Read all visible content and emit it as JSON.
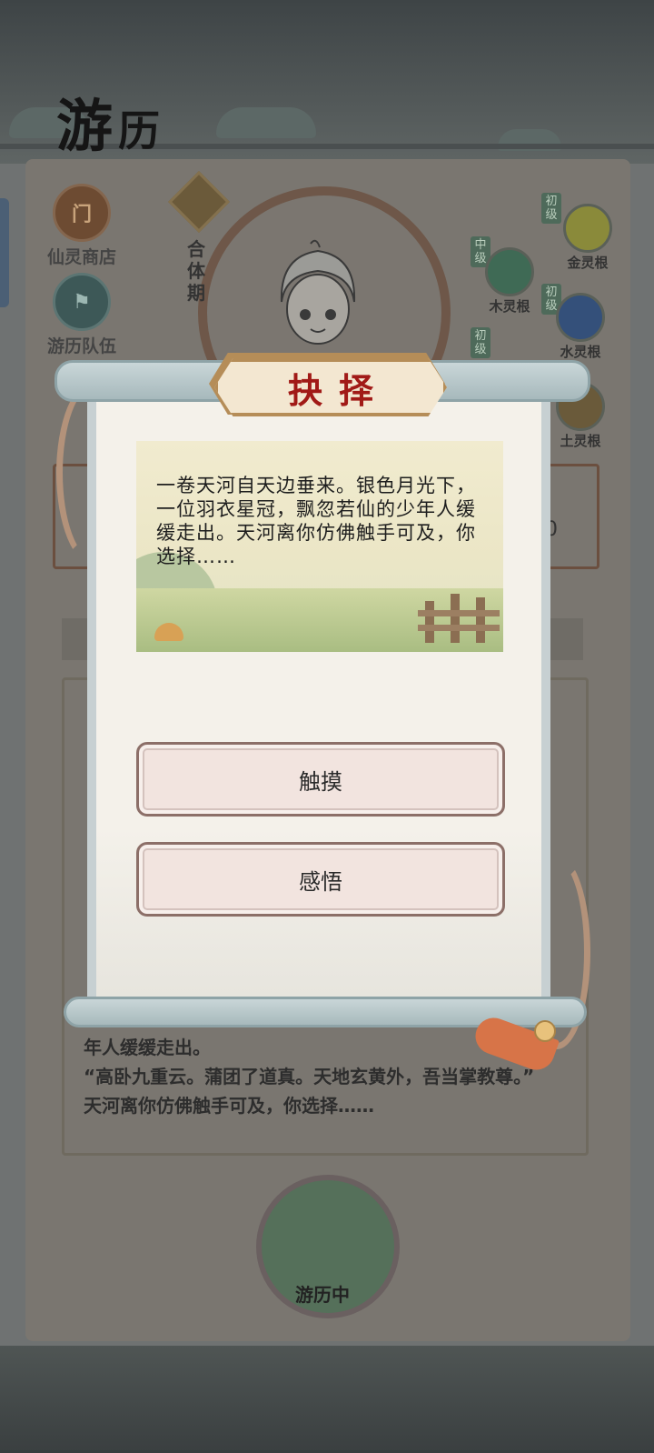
{
  "page": {
    "title_first": "游",
    "title_second": "历"
  },
  "side_buttons": {
    "shop_label": "仙灵商店",
    "team_label": "游历队伍"
  },
  "character": {
    "realm": "合体期"
  },
  "spirit_roots": [
    {
      "grade": "初级",
      "label": "金灵根",
      "color": "#8a8a3a"
    },
    {
      "grade": "中级",
      "label": "木灵根",
      "color": "#3f6a55"
    },
    {
      "grade": "初级",
      "label": "水灵根",
      "color": "#34507a"
    },
    {
      "grade": "初级",
      "label": "",
      "color": "#6a3e30"
    },
    {
      "grade": "",
      "label": "土灵根",
      "color": "#6a5a3a"
    }
  ],
  "background": {
    "row_value": "0",
    "log_lines": [
      "年人缓缓走出。",
      "“高卧九重云。蒲团了道真。天地玄黄外，吾当掌教尊。”",
      "天河离你仿佛触手可及，你选择……"
    ],
    "status_label": "游历中"
  },
  "dialog": {
    "title": "抉择",
    "story": "一卷天河自天边垂来。银色月光下，一位羽衣星冠，飘忽若仙的少年人缓缓走出。天河离你仿佛触手可及，你选择……",
    "options": [
      "触摸",
      "感悟"
    ]
  }
}
